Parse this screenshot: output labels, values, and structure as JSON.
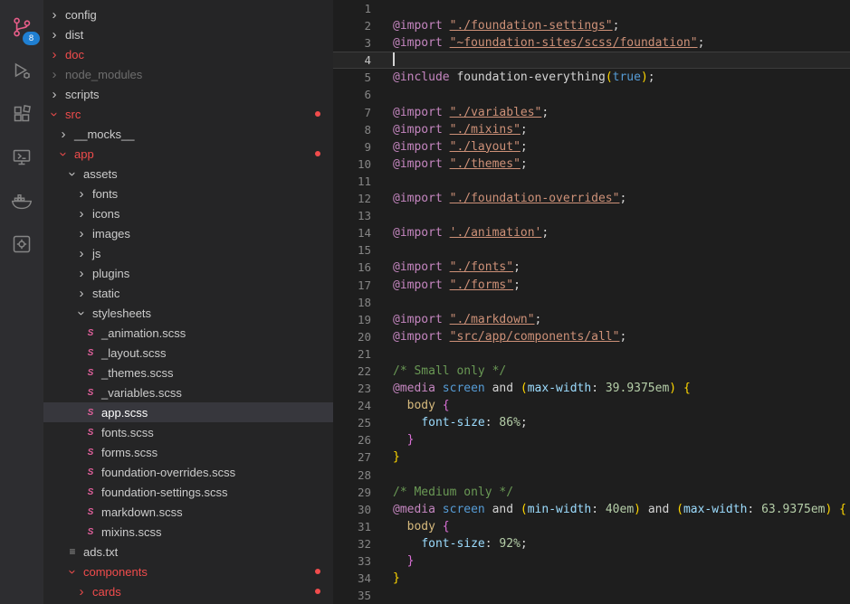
{
  "colors": {
    "editor_bg": "#1e1e1e",
    "sidebar_bg": "#252526",
    "activitybar_bg": "#2d2d30",
    "selection_bg": "#37373d",
    "error_red": "#f14c4c",
    "sass_pink": "#e0609b",
    "icon_pink": "#ea5e8a",
    "badge_blue": "#1f7fd2",
    "keyword_pink": "#c586c0",
    "string_orange": "#ce9178",
    "comment_green": "#6a9955",
    "number_green": "#b5cea8",
    "property_blue": "#9cdcfe",
    "selector_gold": "#d7ba7d",
    "constant_blue": "#569cd6",
    "bracket_gold": "#ffd700",
    "bracket_purple": "#da70d6"
  },
  "glyphs": {
    "chevron": "›",
    "scss": "S",
    "txt": "≡"
  },
  "activity_bar": {
    "items": [
      {
        "name": "source-control",
        "badge": "8"
      },
      {
        "name": "run-and-debug"
      },
      {
        "name": "extensions"
      },
      {
        "name": "remote-explorer"
      },
      {
        "name": "docker"
      },
      {
        "name": "settings-tool"
      }
    ]
  },
  "sidebar": {
    "items": [
      {
        "label": "config",
        "type": "folder",
        "depth": 0,
        "expanded": false
      },
      {
        "label": "dist",
        "type": "folder",
        "depth": 0,
        "expanded": false
      },
      {
        "label": "doc",
        "type": "folder",
        "depth": 0,
        "expanded": false,
        "style": "error"
      },
      {
        "label": "node_modules",
        "type": "folder",
        "depth": 0,
        "expanded": false,
        "style": "dim"
      },
      {
        "label": "scripts",
        "type": "folder",
        "depth": 0,
        "expanded": false
      },
      {
        "label": "src",
        "type": "folder",
        "depth": 0,
        "expanded": true,
        "style": "error",
        "dot": true
      },
      {
        "label": "__mocks__",
        "type": "folder",
        "depth": 1,
        "expanded": false
      },
      {
        "label": "app",
        "type": "folder",
        "depth": 1,
        "expanded": true,
        "style": "error",
        "dot": true
      },
      {
        "label": "assets",
        "type": "folder",
        "depth": 2,
        "expanded": true
      },
      {
        "label": "fonts",
        "type": "folder",
        "depth": 3,
        "expanded": false
      },
      {
        "label": "icons",
        "type": "folder",
        "depth": 3,
        "expanded": false
      },
      {
        "label": "images",
        "type": "folder",
        "depth": 3,
        "expanded": false
      },
      {
        "label": "js",
        "type": "folder",
        "depth": 3,
        "expanded": false
      },
      {
        "label": "plugins",
        "type": "folder",
        "depth": 3,
        "expanded": false
      },
      {
        "label": "static",
        "type": "folder",
        "depth": 3,
        "expanded": false
      },
      {
        "label": "stylesheets",
        "type": "folder",
        "depth": 3,
        "expanded": true
      },
      {
        "label": "_animation.scss",
        "type": "file",
        "icon": "scss",
        "depth": 4
      },
      {
        "label": "_layout.scss",
        "type": "file",
        "icon": "scss",
        "depth": 4
      },
      {
        "label": "_themes.scss",
        "type": "file",
        "icon": "scss",
        "depth": 4
      },
      {
        "label": "_variables.scss",
        "type": "file",
        "icon": "scss",
        "depth": 4
      },
      {
        "label": "app.scss",
        "type": "file",
        "icon": "scss",
        "depth": 4,
        "selected": true
      },
      {
        "label": "fonts.scss",
        "type": "file",
        "icon": "scss",
        "depth": 4
      },
      {
        "label": "forms.scss",
        "type": "file",
        "icon": "scss",
        "depth": 4
      },
      {
        "label": "foundation-overrides.scss",
        "type": "file",
        "icon": "scss",
        "depth": 4
      },
      {
        "label": "foundation-settings.scss",
        "type": "file",
        "icon": "scss",
        "depth": 4
      },
      {
        "label": "markdown.scss",
        "type": "file",
        "icon": "scss",
        "depth": 4
      },
      {
        "label": "mixins.scss",
        "type": "file",
        "icon": "scss",
        "depth": 4
      },
      {
        "label": "ads.txt",
        "type": "file",
        "icon": "txt",
        "depth": 2
      },
      {
        "label": "components",
        "type": "folder",
        "depth": 2,
        "expanded": true,
        "style": "error",
        "dot": true
      },
      {
        "label": "cards",
        "type": "folder",
        "depth": 3,
        "expanded": false,
        "style": "error",
        "dot": true
      }
    ]
  },
  "editor": {
    "active_line": 4,
    "lines": [
      {
        "n": 1,
        "tokens": []
      },
      {
        "n": 2,
        "tokens": [
          [
            "@import",
            "kw"
          ],
          [
            " ",
            "pl"
          ],
          [
            "\"./foundation-settings\"",
            "str lnk"
          ],
          [
            ";",
            "pl"
          ]
        ]
      },
      {
        "n": 3,
        "tokens": [
          [
            "@import",
            "kw"
          ],
          [
            " ",
            "pl"
          ],
          [
            "\"~foundation-sites/scss/foundation\"",
            "str lnk"
          ],
          [
            ";",
            "pl"
          ]
        ]
      },
      {
        "n": 4,
        "cursor": true,
        "tokens": []
      },
      {
        "n": 5,
        "tokens": [
          [
            "@include",
            "kw"
          ],
          [
            " ",
            "pl"
          ],
          [
            "foundation-everything",
            "pl"
          ],
          [
            "(",
            "b1"
          ],
          [
            "true",
            "blue"
          ],
          [
            ")",
            "b1"
          ],
          [
            ";",
            "pl"
          ]
        ]
      },
      {
        "n": 6,
        "tokens": []
      },
      {
        "n": 7,
        "tokens": [
          [
            "@import",
            "kw"
          ],
          [
            " ",
            "pl"
          ],
          [
            "\"./variables\"",
            "str lnk"
          ],
          [
            ";",
            "pl"
          ]
        ]
      },
      {
        "n": 8,
        "tokens": [
          [
            "@import",
            "kw"
          ],
          [
            " ",
            "pl"
          ],
          [
            "\"./mixins\"",
            "str lnk"
          ],
          [
            ";",
            "pl"
          ]
        ]
      },
      {
        "n": 9,
        "tokens": [
          [
            "@import",
            "kw"
          ],
          [
            " ",
            "pl"
          ],
          [
            "\"./layout\"",
            "str lnk"
          ],
          [
            ";",
            "pl"
          ]
        ]
      },
      {
        "n": 10,
        "tokens": [
          [
            "@import",
            "kw"
          ],
          [
            " ",
            "pl"
          ],
          [
            "\"./themes\"",
            "str lnk"
          ],
          [
            ";",
            "pl"
          ]
        ]
      },
      {
        "n": 11,
        "tokens": []
      },
      {
        "n": 12,
        "tokens": [
          [
            "@import",
            "kw"
          ],
          [
            " ",
            "pl"
          ],
          [
            "\"./foundation-overrides\"",
            "str lnk"
          ],
          [
            ";",
            "pl"
          ]
        ]
      },
      {
        "n": 13,
        "tokens": []
      },
      {
        "n": 14,
        "tokens": [
          [
            "@import",
            "kw"
          ],
          [
            " ",
            "pl"
          ],
          [
            "'./animation'",
            "str lnk"
          ],
          [
            ";",
            "pl"
          ]
        ]
      },
      {
        "n": 15,
        "tokens": []
      },
      {
        "n": 16,
        "tokens": [
          [
            "@import",
            "kw"
          ],
          [
            " ",
            "pl"
          ],
          [
            "\"./fonts\"",
            "str lnk"
          ],
          [
            ";",
            "pl"
          ]
        ]
      },
      {
        "n": 17,
        "tokens": [
          [
            "@import",
            "kw"
          ],
          [
            " ",
            "pl"
          ],
          [
            "\"./forms\"",
            "str lnk"
          ],
          [
            ";",
            "pl"
          ]
        ]
      },
      {
        "n": 18,
        "tokens": []
      },
      {
        "n": 19,
        "tokens": [
          [
            "@import",
            "kw"
          ],
          [
            " ",
            "pl"
          ],
          [
            "\"./markdown\"",
            "str lnk"
          ],
          [
            ";",
            "pl"
          ]
        ]
      },
      {
        "n": 20,
        "tokens": [
          [
            "@import",
            "kw"
          ],
          [
            " ",
            "pl"
          ],
          [
            "\"src/app/components/all\"",
            "str lnk"
          ],
          [
            ";",
            "pl"
          ]
        ]
      },
      {
        "n": 21,
        "tokens": []
      },
      {
        "n": 22,
        "tokens": [
          [
            "/* Small only */",
            "cmt"
          ]
        ]
      },
      {
        "n": 23,
        "tokens": [
          [
            "@media",
            "kw"
          ],
          [
            " ",
            "pl"
          ],
          [
            "screen",
            "blue"
          ],
          [
            " ",
            "pl"
          ],
          [
            "and",
            "pl"
          ],
          [
            " ",
            "pl"
          ],
          [
            "(",
            "b1"
          ],
          [
            "max-width",
            "prop"
          ],
          [
            ": ",
            "pl"
          ],
          [
            "39.9375em",
            "num"
          ],
          [
            ")",
            "b1"
          ],
          [
            " ",
            "pl"
          ],
          [
            "{",
            "b1"
          ]
        ]
      },
      {
        "n": 24,
        "tokens": [
          [
            "  ",
            "pl"
          ],
          [
            "body",
            "sel"
          ],
          [
            " ",
            "pl"
          ],
          [
            "{",
            "b2"
          ]
        ]
      },
      {
        "n": 25,
        "tokens": [
          [
            "    ",
            "pl"
          ],
          [
            "font-size",
            "prop"
          ],
          [
            ": ",
            "pl"
          ],
          [
            "86%",
            "num"
          ],
          [
            ";",
            "pl"
          ]
        ]
      },
      {
        "n": 26,
        "tokens": [
          [
            "  ",
            "pl"
          ],
          [
            "}",
            "b2"
          ]
        ]
      },
      {
        "n": 27,
        "tokens": [
          [
            "}",
            "b1"
          ]
        ]
      },
      {
        "n": 28,
        "tokens": []
      },
      {
        "n": 29,
        "tokens": [
          [
            "/* Medium only */",
            "cmt"
          ]
        ]
      },
      {
        "n": 30,
        "tokens": [
          [
            "@media",
            "kw"
          ],
          [
            " ",
            "pl"
          ],
          [
            "screen",
            "blue"
          ],
          [
            " ",
            "pl"
          ],
          [
            "and",
            "pl"
          ],
          [
            " ",
            "pl"
          ],
          [
            "(",
            "b1"
          ],
          [
            "min-width",
            "prop"
          ],
          [
            ": ",
            "pl"
          ],
          [
            "40em",
            "num"
          ],
          [
            ")",
            "b1"
          ],
          [
            " ",
            "pl"
          ],
          [
            "and",
            "pl"
          ],
          [
            " ",
            "pl"
          ],
          [
            "(",
            "b1"
          ],
          [
            "max-width",
            "prop"
          ],
          [
            ": ",
            "pl"
          ],
          [
            "63.9375em",
            "num"
          ],
          [
            ")",
            "b1"
          ],
          [
            " ",
            "pl"
          ],
          [
            "{",
            "b1"
          ]
        ]
      },
      {
        "n": 31,
        "tokens": [
          [
            "  ",
            "pl"
          ],
          [
            "body",
            "sel"
          ],
          [
            " ",
            "pl"
          ],
          [
            "{",
            "b2"
          ]
        ]
      },
      {
        "n": 32,
        "tokens": [
          [
            "    ",
            "pl"
          ],
          [
            "font-size",
            "prop"
          ],
          [
            ": ",
            "pl"
          ],
          [
            "92%",
            "num"
          ],
          [
            ";",
            "pl"
          ]
        ]
      },
      {
        "n": 33,
        "tokens": [
          [
            "  ",
            "pl"
          ],
          [
            "}",
            "b2"
          ]
        ]
      },
      {
        "n": 34,
        "tokens": [
          [
            "}",
            "b1"
          ]
        ]
      },
      {
        "n": 35,
        "tokens": []
      }
    ]
  }
}
